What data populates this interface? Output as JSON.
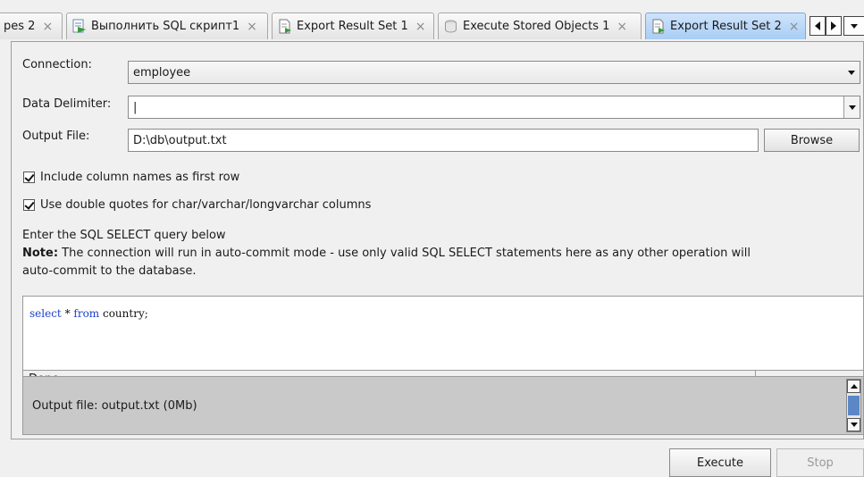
{
  "tabs": [
    {
      "label": "pes 2",
      "icon": "none",
      "active": false
    },
    {
      "label": "Выполнить SQL скрипт1",
      "icon": "sql-script-icon",
      "active": false
    },
    {
      "label": "Export Result Set 1",
      "icon": "export-document-icon",
      "active": false
    },
    {
      "label": "Execute Stored Objects 1",
      "icon": "stored-objects-icon",
      "active": false
    },
    {
      "label": "Export Result Set 2",
      "icon": "export-document-icon",
      "active": true
    }
  ],
  "tab_close_glyph": "×",
  "form": {
    "connection_label": "Connection:",
    "connection_value": "employee",
    "delimiter_label": "Data Delimiter:",
    "delimiter_value": "|",
    "output_label": "Output File:",
    "output_value": "D:\\db\\output.txt",
    "browse_label": "Browse",
    "include_columns_label": "Include column names as first row",
    "include_columns_checked": true,
    "double_quotes_label": "Use double quotes for char/varchar/longvarchar columns",
    "double_quotes_checked": true
  },
  "instructions": {
    "line1": "Enter the SQL SELECT query below",
    "note_label": "Note:",
    "note_text": " The connection will run in auto-commit mode - use only valid SQL SELECT statements here as any other operation will",
    "note_text2": "auto-commit to the database."
  },
  "editor": {
    "kw1": "select",
    "mid": " * ",
    "kw2": "from",
    "rest": " country;",
    "status": "Done"
  },
  "output": {
    "text": "Output file: output.txt (0Mb)"
  },
  "actions": {
    "execute_label": "Execute",
    "stop_label": "Stop"
  },
  "colors": {
    "active_tab": "#a9cdf5",
    "sql_keyword": "#1b3fcf",
    "output_bg": "#c9c9c9"
  }
}
